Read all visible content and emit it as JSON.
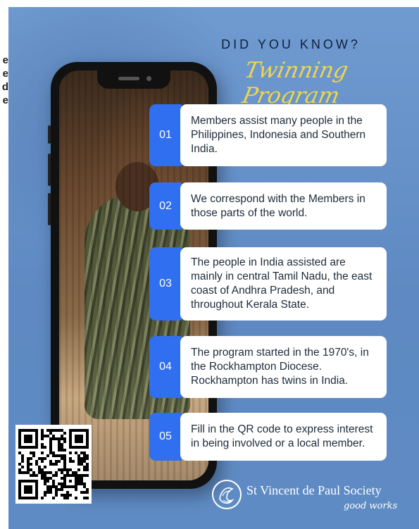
{
  "edge_text": [
    "e",
    "e",
    "d",
    "e"
  ],
  "heading": {
    "did_you_know": "DID YOU KNOW?",
    "program": "Twinning Program"
  },
  "facts": [
    {
      "number": "01",
      "text": "Members assist many people in the Philippines, Indonesia and Southern India."
    },
    {
      "number": "02",
      "text": "We correspond with the Members in those parts of the world."
    },
    {
      "number": "03",
      "text": "The people in India assisted are mainly in central Tamil Nadu, the east coast of Andhra Pradesh, and throughout Kerala State."
    },
    {
      "number": "04",
      "text": "The program started in the 1970's, in the Rockhampton Diocese. Rockhampton has twins in India."
    },
    {
      "number": "05",
      "text": "Fill in the QR code to express interest in being involved or a local member."
    }
  ],
  "org": {
    "name": "St Vincent de Paul Society",
    "tagline": "good works"
  },
  "colors": {
    "background": "#6a96cf",
    "number_badge": "#2f6ff0",
    "script_title": "#f1d64a"
  },
  "icons": {
    "qr": "qr-code-icon",
    "emblem": "svdp-emblem-icon"
  }
}
